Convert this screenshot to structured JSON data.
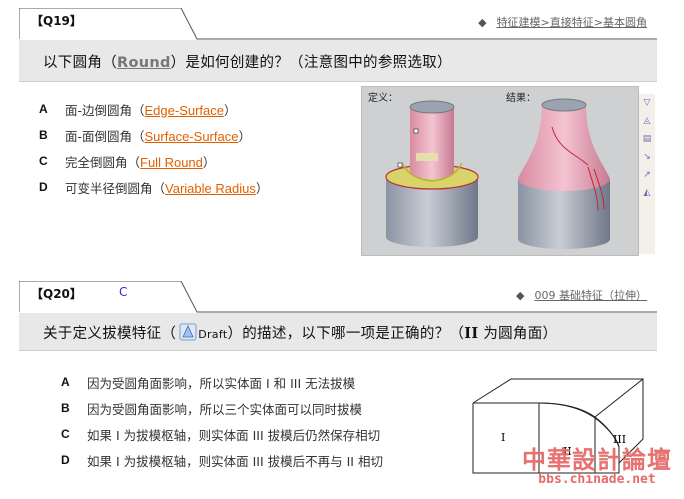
{
  "q19": {
    "tag": "【Q19】",
    "breadcrumb": "特征建模>直接特征>基本圆角",
    "question_pre": "以下圆角（",
    "question_keyword": "Round",
    "question_post": "）是如何创建的？（注意图中的参照选取）",
    "options": [
      {
        "letter": "A",
        "text": "面-边倒圆角（",
        "link": "Edge-Surface",
        "close": "）"
      },
      {
        "letter": "B",
        "text": "面-面倒圆角（",
        "link": "Surface-Surface",
        "close": "）"
      },
      {
        "letter": "C",
        "text": "完全倒圆角（",
        "link": "Full Round",
        "close": "）"
      },
      {
        "letter": "D",
        "text": "可变半径倒圆角（",
        "link": "Variable Radius",
        "close": "）"
      }
    ],
    "figure": {
      "left_label": "定义：",
      "right_label": "结果："
    }
  },
  "q20": {
    "tag": "【Q20】",
    "mark": "C",
    "breadcrumb": "009 基础特征（拉伸）",
    "question_pre": "关于定义拔模特征（",
    "draft_word": "Draft",
    "question_mid": "）的描述，以下哪一项是正确的？（",
    "roman_two": "II",
    "question_post": " 为圆角面）",
    "options": [
      {
        "letter": "A",
        "text": "因为受圆角面影响，所以实体面 I 和 III 无法拔模"
      },
      {
        "letter": "B",
        "text": "因为受圆角面影响，所以三个实体面可以同时拔模"
      },
      {
        "letter": "C",
        "text": "如果 I 为拔模枢轴，则实体面 III 拔模后仍然保存相切"
      },
      {
        "letter": "D",
        "text": "如果 I 为拔模枢轴，则实体面 III 拔模后不再与 II 相切"
      }
    ],
    "figure_labels": [
      "I",
      "II",
      "III"
    ]
  },
  "watermark": {
    "cn": "中華設計論壇",
    "url": "bbs.chinade.net"
  },
  "colors": {
    "link": "#e06000",
    "bar": "#e8e8e8",
    "watermark": "#e56b6b"
  }
}
